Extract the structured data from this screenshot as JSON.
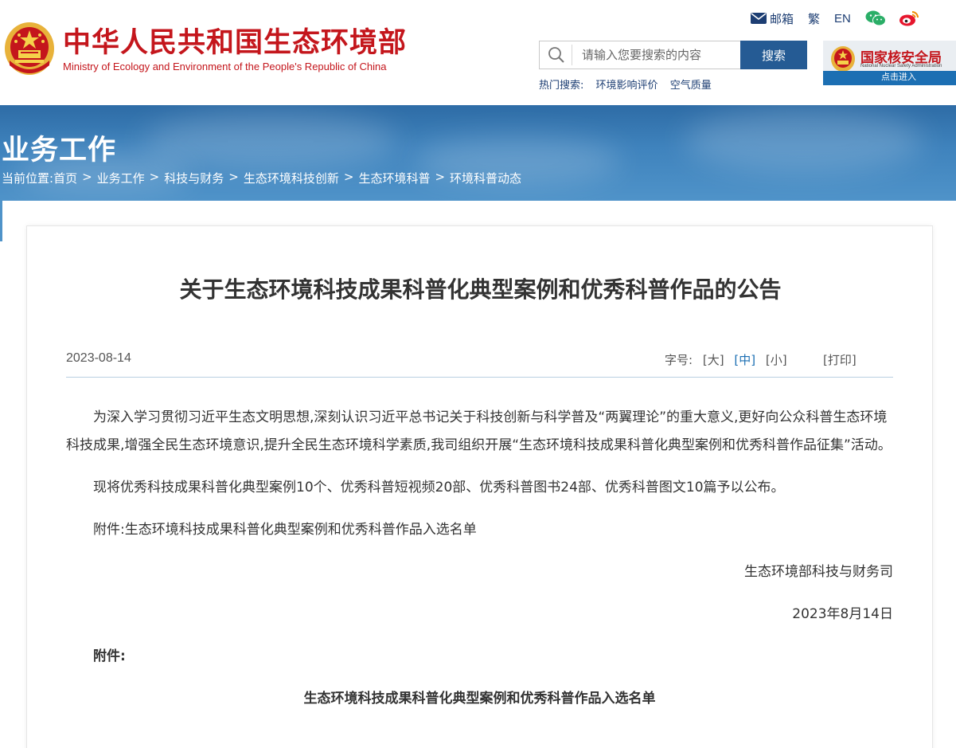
{
  "header": {
    "title_cn": "中华人民共和国生态环境部",
    "title_en": "Ministry of Ecology and Environment of the People's Republic of China",
    "links": {
      "mail": "邮箱",
      "traditional": "繁",
      "english": "EN"
    },
    "search": {
      "placeholder": "请输入您要搜索的内容",
      "button": "搜索"
    },
    "hot_search": {
      "label": "热门搜索:",
      "items": [
        "环境影响评价",
        "空气质量"
      ]
    },
    "nnsa": {
      "title_cn": "国家核安全局",
      "title_en": "National Nuclear Safety Administration",
      "enter": "点击进入"
    }
  },
  "banner": {
    "section_title": "业务工作",
    "breadcrumb": {
      "label": "当前位置:",
      "sep": ">",
      "items": [
        "首页",
        "业务工作",
        "科技与财务",
        "生态环境科技创新",
        "生态环境科普",
        "环境科普动态"
      ]
    }
  },
  "article": {
    "title": "关于生态环境科技成果科普化典型案例和优秀科普作品的公告",
    "date": "2023-08-14",
    "font_tools": {
      "label": "字号:",
      "large": "[大]",
      "medium": "[中]",
      "small": "[小]",
      "print": "[打印]"
    },
    "paragraphs": [
      "为深入学习贯彻习近平生态文明思想,深刻认识习近平总书记关于科技创新与科学普及“两翼理论”的重大意义,更好向公众科普生态环境科技成果,增强全民生态环境意识,提升全民生态环境科学素质,我司组织开展“生态环境科技成果科普化典型案例和优秀科普作品征集”活动。",
      "现将优秀科技成果科普化典型案例10个、优秀科普短视频20部、优秀科普图书24部、优秀科普图文10篇予以公布。",
      "附件:生态环境科技成果科普化典型案例和优秀科普作品入选名单"
    ],
    "signature": "生态环境部科技与财务司",
    "sign_date": "2023年8月14日",
    "attachment_label": "附件:",
    "attachment_title": "生态环境科技成果科普化典型案例和优秀科普作品入选名单"
  },
  "colors": {
    "brand_red": "#c4161c",
    "nav_blue": "#255b94",
    "link_blue": "#1d3e73"
  }
}
